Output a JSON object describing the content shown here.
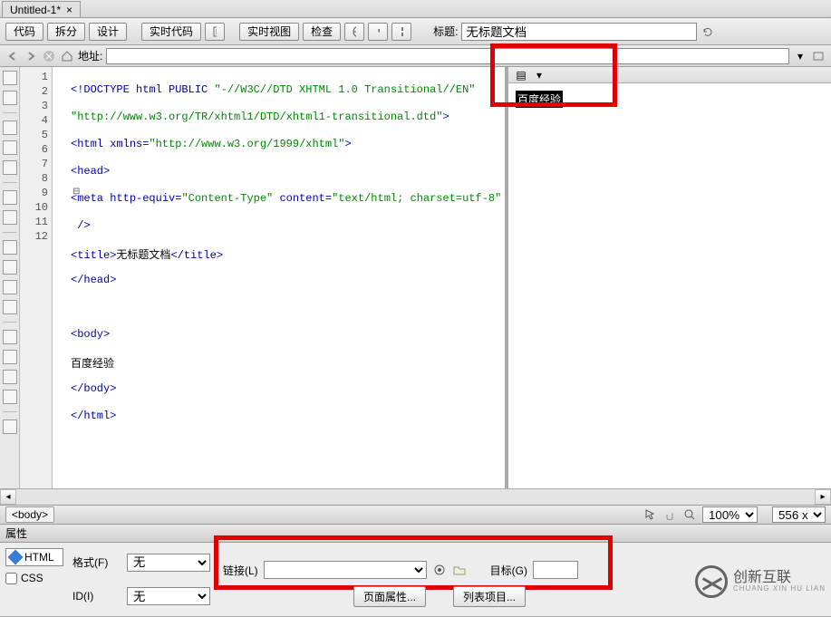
{
  "tab": {
    "label": "Untitled-1*",
    "close": "×"
  },
  "toolbar": {
    "code": "代码",
    "split": "拆分",
    "design": "设计",
    "livecode": "实时代码",
    "liveview": "实时视图",
    "inspect": "检查",
    "titlelabel": "标题:",
    "titlevalue": "无标题文档"
  },
  "addr": {
    "label": "地址:"
  },
  "lines": [
    "1",
    "2",
    "3",
    "4",
    "5",
    "6",
    "7",
    "8",
    "9",
    "10",
    "11",
    "12"
  ],
  "code": {
    "l1a": "<!DOCTYPE html PUBLIC ",
    "l1b": "\"-//W3C//DTD XHTML 1.0 Transitional//EN\"",
    "l1c": "\"http://www.w3.org/TR/xhtml1/DTD/xhtml1-transitional.dtd\"",
    "l1d": ">",
    "l2a": "<html ",
    "l2b": "xmlns=",
    "l2c": "\"http://www.w3.org/1999/xhtml\"",
    "l2d": ">",
    "l3": "<head>",
    "l4a": "<meta ",
    "l4b": "http-equiv=",
    "l4c": "\"Content-Type\"",
    "l4d": " content=",
    "l4e": "\"text/html; charset=utf-8\"",
    "l4f": " />",
    "l5a": "<title>",
    "l5b": "无标题文档",
    "l5c": "</title>",
    "l6": "</head>",
    "l7": "",
    "l8": "<body>",
    "l9": "百度经验",
    "l10": "</body>",
    "l11": "</html>"
  },
  "preview": {
    "text": "百度经验"
  },
  "status": {
    "body": "<body>",
    "zoom": "100%",
    "dims": "556 x"
  },
  "props": {
    "header": "属性",
    "html": "HTML",
    "css": "CSS",
    "formatlabel": "格式(F)",
    "formatvalue": "无",
    "idlabel": "ID(I)",
    "idvalue": "无",
    "linklabel": "链接(L)",
    "targetlabel": "目标(G)",
    "pageprops": "页面属性...",
    "listitem": "列表项目..."
  },
  "watermark": {
    "main": "创新互联",
    "sub": "CHUANG XIN HU LIAN"
  }
}
